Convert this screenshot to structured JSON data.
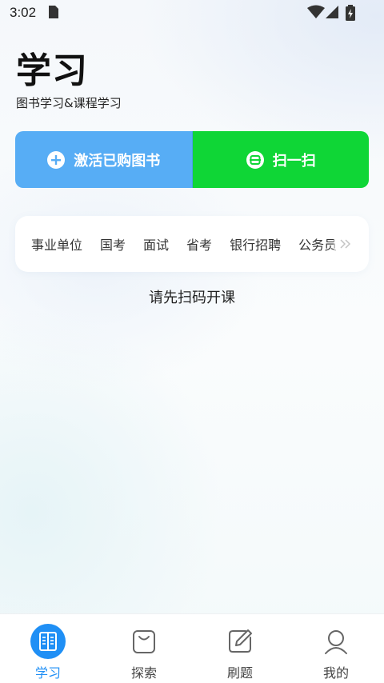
{
  "status_bar": {
    "time": "3:02"
  },
  "header": {
    "title": "学习",
    "subtitle": "图书学习&课程学习"
  },
  "actions": {
    "activate_label": "激活已购图书",
    "scan_label": "扫一扫"
  },
  "categories": [
    "事业单位",
    "国考",
    "面试",
    "省考",
    "银行招聘",
    "公务员"
  ],
  "empty_state": {
    "message": "请先扫码开课"
  },
  "tabbar": {
    "items": [
      {
        "label": "学习",
        "icon": "book-icon",
        "active": true
      },
      {
        "label": "探索",
        "icon": "bag-icon",
        "active": false
      },
      {
        "label": "刷题",
        "icon": "edit-icon",
        "active": false
      },
      {
        "label": "我的",
        "icon": "user-icon",
        "active": false
      }
    ]
  },
  "colors": {
    "activate_bg": "#57adf5",
    "scan_bg": "#0fd636",
    "active_tab": "#1f8ff5"
  }
}
